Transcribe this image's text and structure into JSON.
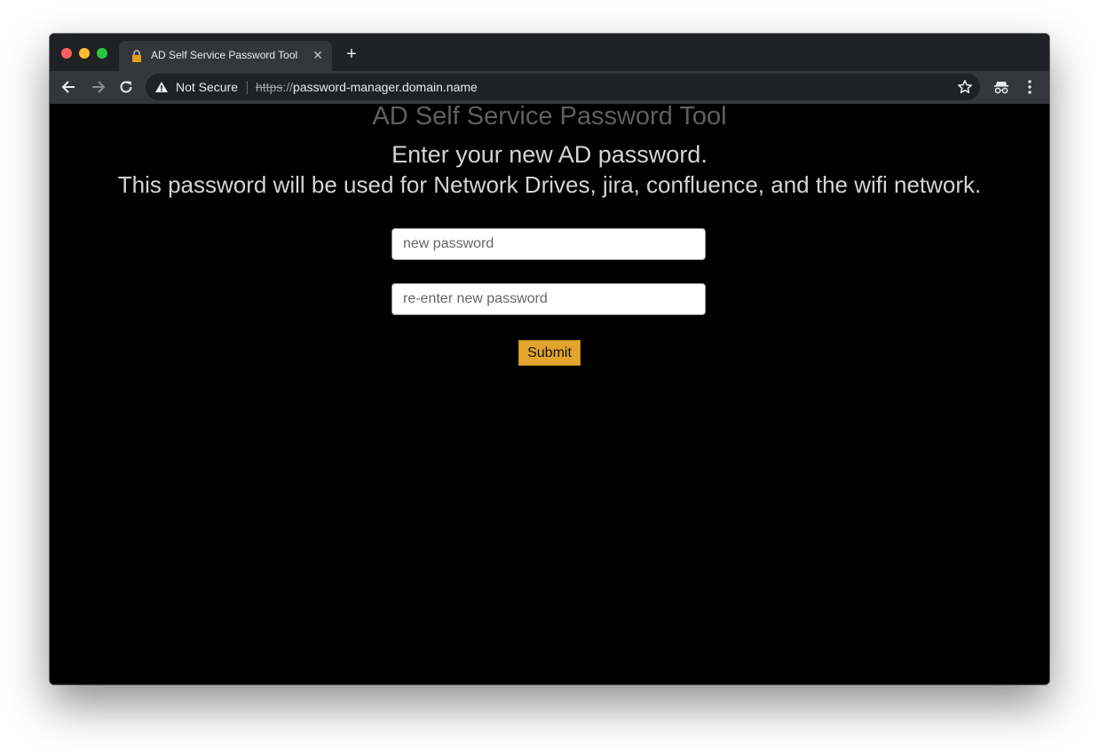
{
  "browser": {
    "tab": {
      "title": "AD Self Service Password Tool"
    },
    "address_bar": {
      "security_label": "Not Secure",
      "url_scheme": "https",
      "url_separator": "://",
      "url_host": "password-manager.domain.name"
    },
    "icons": [
      "back-arrow-icon",
      "forward-arrow-icon",
      "reload-icon",
      "warning-icon",
      "star-icon",
      "incognito-icon",
      "more-vert-icon",
      "close-icon",
      "plus-icon"
    ]
  },
  "page": {
    "site_title": "AD Self Service Password Tool",
    "instruction_line1": "Enter your new AD password.",
    "instruction_line2": "This password will be used for Network Drives, jira, confluence, and the wifi network.",
    "form": {
      "new_password_placeholder": "new password",
      "confirm_password_placeholder": "re-enter new password",
      "submit_label": "Submit"
    }
  },
  "colors": {
    "page_background": "#000000",
    "submit_button": "#e3a52b",
    "site_title": "#5f5f5f",
    "instructions": "#d4d4d4"
  }
}
